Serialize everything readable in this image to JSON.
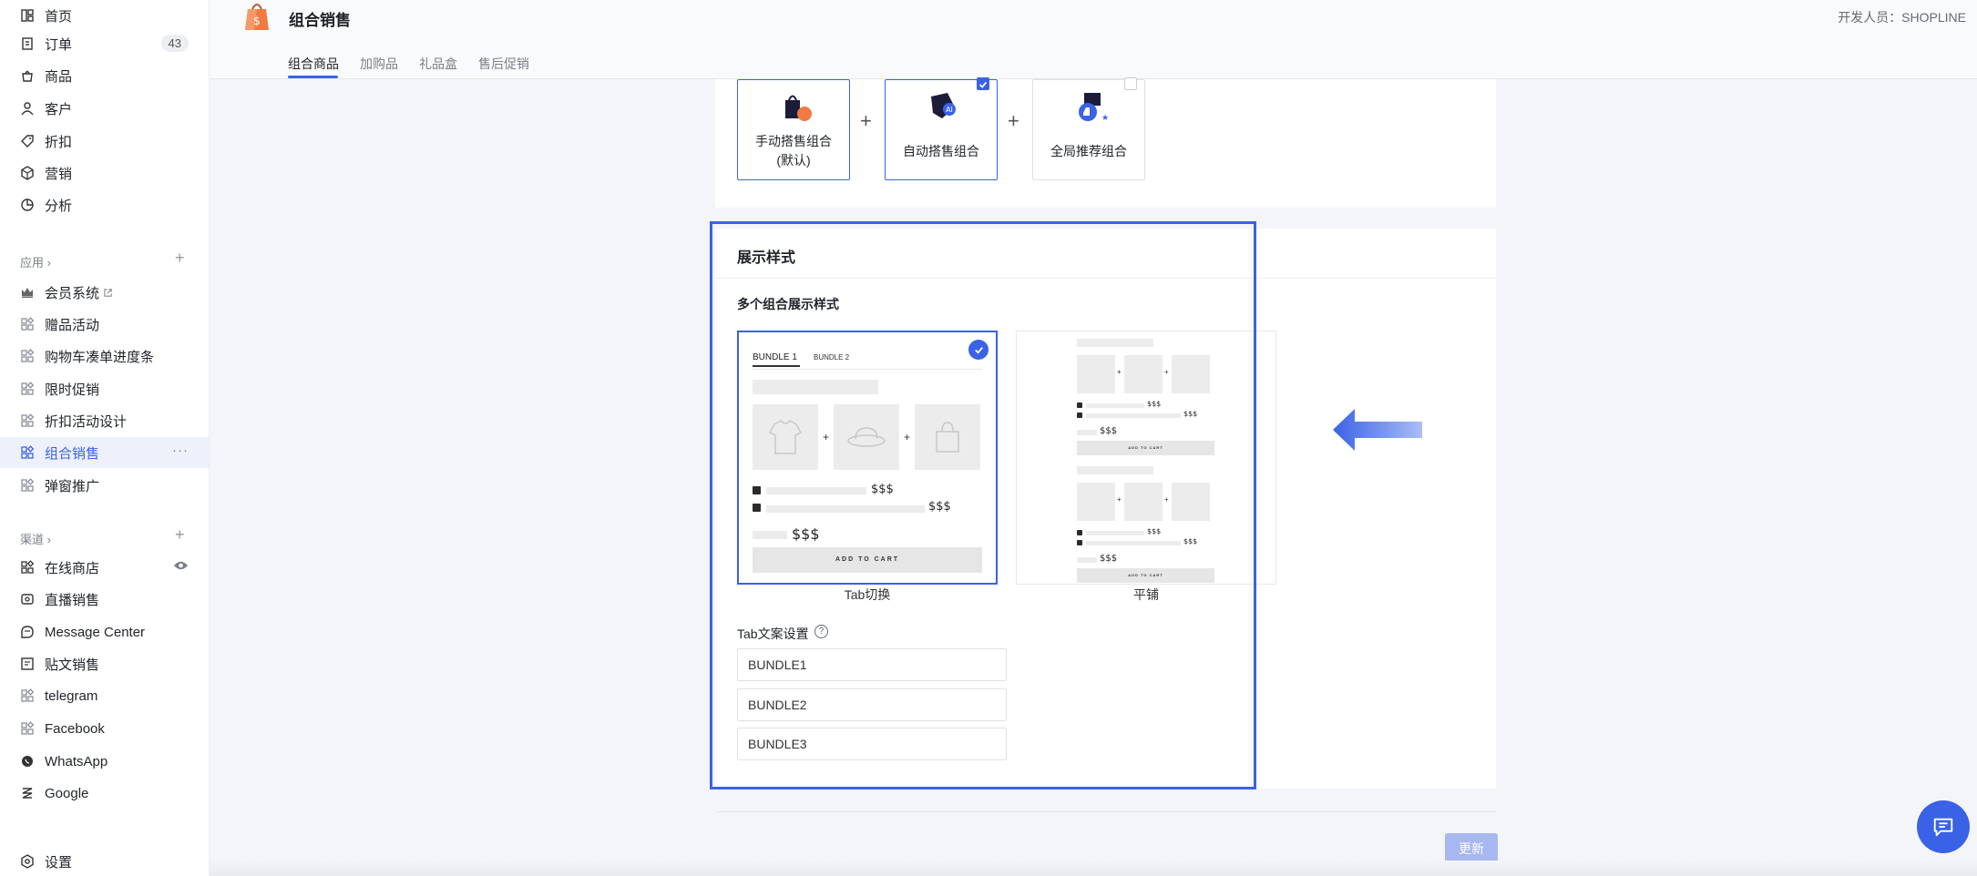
{
  "sidebar": {
    "main": [
      {
        "label": "首页",
        "icon": "home-icon"
      },
      {
        "label": "订单",
        "icon": "order-icon",
        "badge": "43"
      },
      {
        "label": "商品",
        "icon": "product-icon"
      },
      {
        "label": "客户",
        "icon": "customer-icon"
      },
      {
        "label": "折扣",
        "icon": "discount-icon"
      },
      {
        "label": "营销",
        "icon": "marketing-icon"
      },
      {
        "label": "分析",
        "icon": "analytics-icon"
      }
    ],
    "apps_label": "应用",
    "apps": [
      {
        "label": "会员系统",
        "icon": "crown-icon",
        "external": true
      },
      {
        "label": "赠品活动",
        "icon": "app-grid-icon"
      },
      {
        "label": "购物车凑单进度条",
        "icon": "app-grid-icon"
      },
      {
        "label": "限时促销",
        "icon": "app-grid-icon"
      },
      {
        "label": "折扣活动设计",
        "icon": "app-grid-icon"
      },
      {
        "label": "组合销售",
        "icon": "app-grid-icon",
        "active": true
      },
      {
        "label": "弹窗推广",
        "icon": "app-grid-icon"
      }
    ],
    "channels_label": "渠道",
    "channels": [
      {
        "label": "在线商店",
        "icon": "store-icon"
      },
      {
        "label": "直播销售",
        "icon": "live-icon"
      },
      {
        "label": "Message Center",
        "icon": "message-icon"
      },
      {
        "label": "贴文销售",
        "icon": "post-icon"
      },
      {
        "label": "telegram",
        "icon": "app-grid-icon"
      },
      {
        "label": "Facebook",
        "icon": "app-grid-icon"
      },
      {
        "label": "WhatsApp",
        "icon": "whatsapp-icon"
      },
      {
        "label": "Google",
        "icon": "google-icon"
      }
    ],
    "settings": "设置"
  },
  "header": {
    "title": "组合销售",
    "developer": "开发人员：SHOPLINE",
    "tabs": [
      "组合商品",
      "加购品",
      "礼品盒",
      "售后促销"
    ]
  },
  "combos": {
    "items": [
      {
        "label": "手动搭售组合\n(默认)"
      },
      {
        "label": "自动搭售组合",
        "checked": true
      },
      {
        "label": "全局推荐组合",
        "checked": false
      }
    ],
    "plus": "+"
  },
  "display": {
    "title": "展示样式",
    "subtitle": "多个组合展示样式",
    "styles": [
      {
        "caption": "Tab切换",
        "selected": true
      },
      {
        "caption": "平铺",
        "selected": false
      }
    ],
    "preview": {
      "tab1": "BUNDLE 1",
      "tab2": "BUNDLE 2",
      "price": "$$$",
      "add_to_cart": "ADD TO CART",
      "plus": "+"
    },
    "tab_text_label": "Tab文案设置",
    "inputs": [
      "BUNDLE1",
      "BUNDLE2",
      "BUNDLE3"
    ]
  },
  "footer": {
    "update": "更新"
  },
  "colors": {
    "accent": "#3a62e6",
    "highlight_frame": "#3a62e6",
    "disabled_button": "#a7b7ef"
  }
}
